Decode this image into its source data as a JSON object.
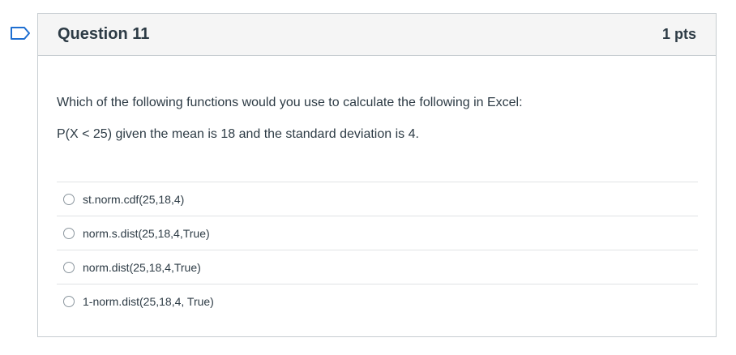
{
  "question": {
    "title": "Question 11",
    "points": "1 pts",
    "prompt_line1": "Which of the following functions would you use to calculate the following in Excel:",
    "prompt_line2": "P(X < 25) given the mean is 18 and the standard deviation is 4."
  },
  "answers": [
    {
      "label": "st.norm.cdf(25,18,4)"
    },
    {
      "label": "norm.s.dist(25,18,4,True)"
    },
    {
      "label": "norm.dist(25,18,4,True)"
    },
    {
      "label": "1-norm.dist(25,18,4, True)"
    }
  ],
  "icons": {
    "flag": "bookmark-flag-icon",
    "radio": "radio-button-icon"
  },
  "colors": {
    "accent": "#1f6fd1",
    "header_bg": "#f5f5f5",
    "border": "#c7cdd1",
    "text": "#2d3b45"
  }
}
